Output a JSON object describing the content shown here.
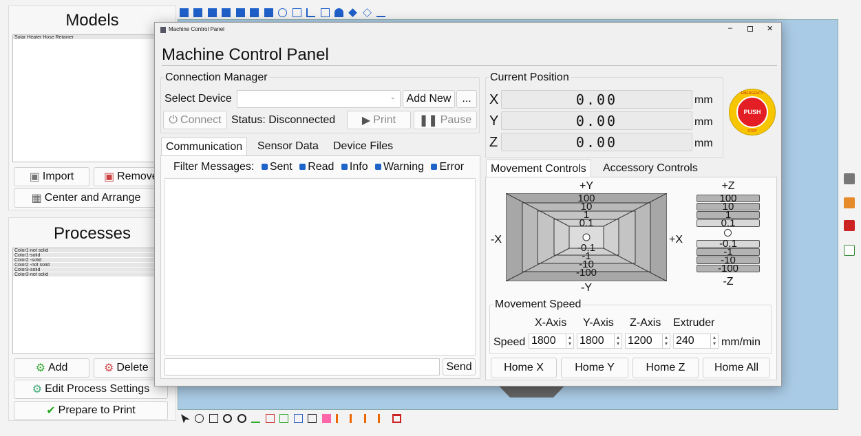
{
  "models": {
    "title": "Models",
    "items": [
      "Solar Heater Hose Retainer"
    ],
    "import_label": "Import",
    "remove_label": "Remove",
    "center_label": "Center and Arrange"
  },
  "processes": {
    "title": "Processes",
    "items": [
      "Color1-not solid",
      "Color1-solid",
      "Color2 -solid",
      "Color2 -not solid",
      "Color3-solid",
      "Color3-not solid"
    ],
    "add_label": "Add",
    "delete_label": "Delete",
    "edit_label": "Edit Process Settings",
    "prepare_label": "Prepare to Print"
  },
  "dialog": {
    "window_title": "Machine Control Panel",
    "heading": "Machine Control Panel",
    "connection": {
      "title": "Connection Manager",
      "select_label": "Select Device",
      "device_value": "",
      "add_new_label": "Add New",
      "more_label": "...",
      "connect_label": "Connect",
      "status_text": "Status: Disconnected",
      "print_label": "Print",
      "pause_label": "Pause"
    },
    "comm_tabs": [
      "Communication",
      "Sensor Data",
      "Device Files"
    ],
    "filter": {
      "label": "Filter Messages:",
      "options": [
        "Sent",
        "Read",
        "Info",
        "Warning",
        "Error"
      ]
    },
    "message_input": "",
    "send_label": "Send",
    "position": {
      "title": "Current Position",
      "axes": [
        {
          "name": "X",
          "value": "0.00",
          "unit": "mm"
        },
        {
          "name": "Y",
          "value": "0.00",
          "unit": "mm"
        },
        {
          "name": "Z",
          "value": "0.00",
          "unit": "mm"
        }
      ]
    },
    "estop": {
      "top": "EMERGENCY",
      "center": "PUSH",
      "bottom": "STOP"
    },
    "move_tabs": [
      "Movement Controls",
      "Accessory Controls"
    ],
    "xy": {
      "plus_y": "+Y",
      "minus_y": "-Y",
      "plus_x": "+X",
      "minus_x": "-X",
      "steps_up": [
        "100",
        "10",
        "1",
        "0.1"
      ],
      "steps_down": [
        "-0.1",
        "-1",
        "-10",
        "-100"
      ]
    },
    "z": {
      "plus": "+Z",
      "minus": "-Z",
      "steps_up": [
        "100",
        "10",
        "1",
        "0.1"
      ],
      "steps_down": [
        "-0.1",
        "-1",
        "-10",
        "-100"
      ]
    },
    "speed": {
      "title": "Movement Speed",
      "row_label": "Speed",
      "columns": [
        "X-Axis",
        "Y-Axis",
        "Z-Axis",
        "Extruder"
      ],
      "values": [
        "1800",
        "1800",
        "1200",
        "240"
      ],
      "unit": "mm/min"
    },
    "home": [
      "Home X",
      "Home Y",
      "Home Z",
      "Home All"
    ]
  },
  "colors": {
    "accent": "#1d63c8",
    "estop_red": "#e31e24",
    "estop_yellow": "#f7c600"
  }
}
